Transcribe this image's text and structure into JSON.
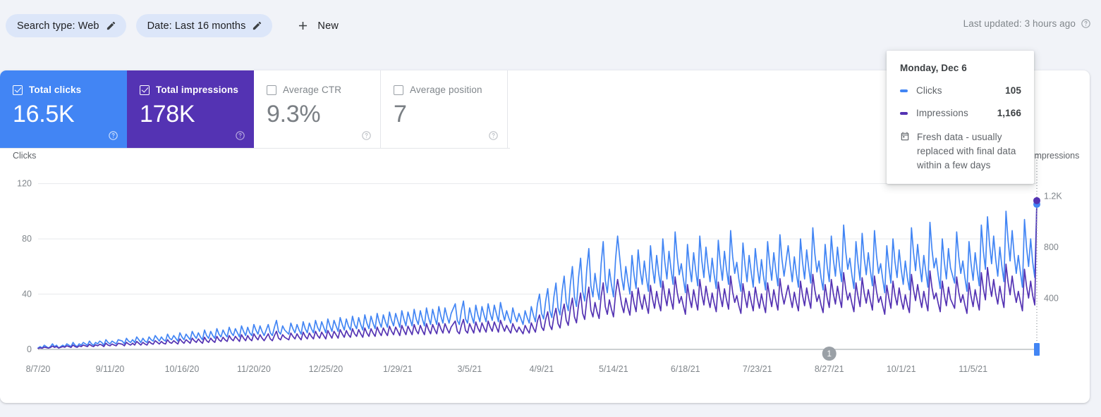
{
  "filters": {
    "chips": [
      {
        "label": "Search type: Web",
        "icon": "pencil-icon"
      },
      {
        "label": "Date: Last 16 months",
        "icon": "pencil-icon"
      }
    ],
    "new_button": {
      "label": "New",
      "icon": "plus-icon"
    },
    "last_updated": {
      "text": "Last updated: 3 hours ago",
      "icon": "help-circle-icon"
    }
  },
  "metrics": [
    {
      "name": "Total clicks",
      "value": "16.5K",
      "checked": true,
      "state": "selected",
      "color": "#4285f4"
    },
    {
      "name": "Total impressions",
      "value": "178K",
      "checked": true,
      "state": "selected",
      "color": "#5433b3"
    },
    {
      "name": "Average CTR",
      "value": "9.3%",
      "checked": false,
      "state": "unselected",
      "color": "#ffffff"
    },
    {
      "name": "Average position",
      "value": "7",
      "checked": false,
      "state": "unselected",
      "color": "#ffffff"
    }
  ],
  "tooltip": {
    "date": "Monday, Dec 6",
    "rows": [
      {
        "label": "Clicks",
        "value": "105",
        "color": "#4285f4"
      },
      {
        "label": "Impressions",
        "value": "1,166",
        "color": "#5433b3"
      }
    ],
    "note": "Fresh data - usually replaced with final data within a few days",
    "note_icon": "calendar-icon"
  },
  "annotations": [
    {
      "number": "1",
      "x_label": "8/27/21"
    }
  ],
  "chart_data": {
    "type": "line",
    "title": "",
    "xlabel": "",
    "ylabel": "Clicks",
    "y2label": "Impressions",
    "grid": true,
    "legend_position": "tooltip",
    "left_axis": {
      "label": "Clicks",
      "ticks": [
        0,
        40,
        80,
        120
      ],
      "tick_labels": [
        "0",
        "40",
        "80",
        "120"
      ],
      "ylim": [
        0,
        130
      ]
    },
    "right_axis": {
      "label": "Impressions",
      "ticks": [
        0,
        400,
        800,
        1200
      ],
      "tick_labels": [
        "",
        "400",
        "800",
        "1.2K"
      ],
      "ylim": [
        0,
        1408
      ]
    },
    "x_tick_labels": [
      "8/7/20",
      "9/11/20",
      "10/16/20",
      "11/20/20",
      "12/25/20",
      "1/29/21",
      "3/5/21",
      "4/9/21",
      "5/14/21",
      "6/18/21",
      "7/23/21",
      "8/27/21",
      "10/1/21",
      "11/5/21"
    ],
    "x_tick_step_days": 35,
    "total_days": 487,
    "hover_index": 486,
    "hover_date": "Monday, Dec 6",
    "series": [
      {
        "name": "Clicks",
        "color": "#4285f4",
        "axis": "left",
        "units": "clicks",
        "hover_value": 105,
        "values": [
          1,
          2,
          1,
          3,
          2,
          1,
          2,
          4,
          2,
          3,
          1,
          2,
          3,
          2,
          4,
          3,
          2,
          5,
          3,
          2,
          4,
          3,
          5,
          4,
          3,
          6,
          4,
          3,
          5,
          4,
          6,
          5,
          3,
          7,
          5,
          4,
          6,
          5,
          4,
          7,
          6,
          4,
          8,
          6,
          5,
          7,
          5,
          9,
          7,
          5,
          8,
          6,
          5,
          9,
          7,
          6,
          10,
          8,
          6,
          9,
          7,
          6,
          11,
          8,
          7,
          10,
          8,
          6,
          12,
          9,
          7,
          11,
          9,
          7,
          13,
          10,
          8,
          12,
          9,
          7,
          14,
          10,
          8,
          13,
          10,
          8,
          15,
          11,
          9,
          14,
          11,
          9,
          16,
          12,
          10,
          15,
          12,
          9,
          17,
          13,
          10,
          16,
          12,
          10,
          18,
          14,
          11,
          17,
          13,
          10,
          14,
          18,
          12,
          10,
          16,
          21,
          13,
          11,
          17,
          14,
          11,
          19,
          15,
          12,
          18,
          14,
          11,
          20,
          15,
          12,
          19,
          15,
          12,
          21,
          16,
          13,
          20,
          16,
          12,
          22,
          17,
          13,
          21,
          17,
          13,
          23,
          18,
          14,
          22,
          17,
          14,
          24,
          18,
          15,
          23,
          18,
          14,
          25,
          19,
          15,
          24,
          19,
          15,
          26,
          20,
          16,
          25,
          20,
          16,
          27,
          21,
          17,
          26,
          21,
          16,
          28,
          22,
          17,
          27,
          22,
          17,
          29,
          22,
          18,
          28,
          22,
          17,
          30,
          23,
          18,
          29,
          23,
          18,
          31,
          24,
          19,
          30,
          24,
          19,
          26,
          33,
          21,
          18,
          28,
          35,
          22,
          19,
          30,
          24,
          19,
          32,
          25,
          20,
          31,
          25,
          20,
          33,
          26,
          21,
          32,
          26,
          20,
          34,
          27,
          21,
          28,
          23,
          19,
          30,
          24,
          20,
          26,
          22,
          18,
          28,
          23,
          19,
          31,
          25,
          20,
          33,
          40,
          26,
          22,
          35,
          44,
          28,
          23,
          38,
          48,
          30,
          25,
          42,
          53,
          34,
          28,
          47,
          60,
          38,
          31,
          52,
          66,
          42,
          35,
          58,
          73,
          46,
          38,
          55,
          44,
          36,
          62,
          78,
          50,
          41,
          58,
          47,
          38,
          65,
          82,
          52,
          43,
          60,
          49,
          40,
          68,
          54,
          44,
          72,
          57,
          47,
          64,
          52,
          42,
          75,
          59,
          48,
          68,
          55,
          45,
          80,
          63,
          51,
          71,
          58,
          47,
          85,
          67,
          54,
          62,
          51,
          41,
          76,
          60,
          49,
          70,
          57,
          46,
          82,
          64,
          52,
          74,
          60,
          49,
          66,
          54,
          44,
          79,
          62,
          50,
          71,
          58,
          47,
          86,
          67,
          55,
          63,
          51,
          42,
          77,
          61,
          49,
          68,
          56,
          45,
          73,
          59,
          48,
          65,
          53,
          43,
          78,
          62,
          50,
          70,
          57,
          46,
          83,
          65,
          53,
          75,
          61,
          49,
          67,
          55,
          45,
          80,
          63,
          51,
          72,
          59,
          48,
          88,
          69,
          56,
          64,
          52,
          43,
          76,
          60,
          49,
          82,
          65,
          53,
          74,
          60,
          49,
          90,
          71,
          58,
          66,
          54,
          44,
          78,
          62,
          50,
          84,
          66,
          54,
          70,
          57,
          46,
          86,
          68,
          55,
          62,
          51,
          41,
          75,
          60,
          48,
          80,
          63,
          52,
          72,
          58,
          47,
          64,
          52,
          43,
          88,
          70,
          57,
          76,
          61,
          49,
          68,
          56,
          45,
          92,
          72,
          59,
          66,
          54,
          44,
          80,
          63,
          51,
          73,
          59,
          48,
          85,
          67,
          55,
          64,
          52,
          42,
          78,
          62,
          50,
          70,
          57,
          46,
          90,
          71,
          58,
          96,
          76,
          62,
          82,
          65,
          53,
          74,
          60,
          49,
          100,
          79,
          64,
          86,
          68,
          55,
          68,
          56,
          45,
          94,
          74,
          60,
          80,
          63,
          52,
          105
        ]
      },
      {
        "name": "Impressions",
        "color": "#5433b3",
        "axis": "right",
        "units": "impressions",
        "hover_value": 1166,
        "values": [
          8,
          12,
          9,
          18,
          14,
          10,
          15,
          26,
          16,
          22,
          11,
          16,
          22,
          17,
          28,
          22,
          15,
          34,
          22,
          16,
          28,
          22,
          34,
          28,
          22,
          40,
          28,
          22,
          36,
          28,
          40,
          34,
          22,
          48,
          34,
          28,
          42,
          34,
          28,
          48,
          40,
          28,
          55,
          42,
          34,
          48,
          34,
          62,
          48,
          34,
          55,
          42,
          34,
          62,
          48,
          40,
          68,
          55,
          42,
          62,
          48,
          42,
          76,
          55,
          48,
          68,
          55,
          42,
          82,
          62,
          48,
          76,
          62,
          48,
          88,
          68,
          55,
          82,
          62,
          48,
          95,
          68,
          55,
          88,
          68,
          55,
          102,
          75,
          62,
          95,
          75,
          62,
          108,
          82,
          68,
          102,
          82,
          62,
          115,
          88,
          68,
          108,
          82,
          68,
          122,
          95,
          75,
          115,
          88,
          68,
          95,
          122,
          82,
          68,
          108,
          142,
          88,
          75,
          115,
          95,
          75,
          128,
          102,
          82,
          122,
          95,
          75,
          135,
          102,
          82,
          128,
          102,
          82,
          142,
          108,
          88,
          135,
          108,
          82,
          148,
          115,
          88,
          142,
          115,
          88,
          155,
          122,
          95,
          148,
          115,
          95,
          162,
          122,
          102,
          155,
          122,
          95,
          168,
          128,
          102,
          162,
          128,
          102,
          175,
          135,
          108,
          168,
          135,
          108,
          182,
          142,
          115,
          175,
          142,
          108,
          188,
          148,
          115,
          182,
          148,
          115,
          195,
          148,
          122,
          188,
          148,
          115,
          202,
          155,
          122,
          195,
          155,
          122,
          208,
          162,
          128,
          202,
          162,
          128,
          175,
          222,
          142,
          122,
          188,
          235,
          148,
          128,
          202,
          162,
          128,
          215,
          168,
          135,
          208,
          168,
          135,
          222,
          175,
          142,
          215,
          175,
          135,
          228,
          182,
          142,
          188,
          155,
          128,
          202,
          162,
          135,
          175,
          148,
          122,
          188,
          155,
          128,
          208,
          168,
          135,
          222,
          270,
          175,
          148,
          235,
          295,
          188,
          155,
          255,
          322,
          202,
          168,
          282,
          355,
          228,
          188,
          315,
          402,
          255,
          208,
          348,
          442,
          282,
          235,
          388,
          488,
          308,
          255,
          368,
          295,
          242,
          415,
          522,
          335,
          275,
          388,
          315,
          255,
          435,
          548,
          348,
          288,
          402,
          328,
          268,
          455,
          362,
          295,
          482,
          382,
          315,
          428,
          348,
          282,
          502,
          395,
          322,
          455,
          368,
          302,
          535,
          422,
          342,
          475,
          388,
          315,
          568,
          448,
          362,
          415,
          342,
          275,
          508,
          402,
          328,
          468,
          382,
          308,
          548,
          428,
          348,
          495,
          402,
          328,
          442,
          362,
          295,
          528,
          415,
          335,
          475,
          388,
          315,
          575,
          448,
          368,
          422,
          342,
          282,
          515,
          408,
          328,
          455,
          375,
          302,
          488,
          395,
          322,
          435,
          355,
          288,
          522,
          415,
          335,
          468,
          382,
          308,
          555,
          435,
          355,
          502,
          408,
          328,
          448,
          368,
          302,
          535,
          422,
          342,
          482,
          395,
          322,
          588,
          462,
          375,
          428,
          348,
          288,
          508,
          402,
          328,
          548,
          435,
          355,
          495,
          402,
          328,
          602,
          475,
          388,
          442,
          362,
          295,
          522,
          415,
          335,
          562,
          442,
          362,
          468,
          382,
          308,
          575,
          455,
          368,
          415,
          342,
          275,
          502,
          402,
          322,
          535,
          422,
          348,
          482,
          388,
          315,
          428,
          348,
          288,
          588,
          468,
          382,
          508,
          408,
          328,
          455,
          375,
          302,
          615,
          482,
          395,
          442,
          362,
          295,
          535,
          422,
          342,
          488,
          395,
          322,
          568,
          448,
          368,
          428,
          348,
          282,
          522,
          415,
          335,
          468,
          382,
          308,
          602,
          475,
          388,
          642,
          508,
          415,
          548,
          435,
          355,
          495,
          402,
          328,
          668,
          528,
          428,
          575,
          455,
          368,
          455,
          375,
          302,
          628,
          495,
          402,
          535,
          422,
          348,
          1166
        ]
      }
    ]
  }
}
